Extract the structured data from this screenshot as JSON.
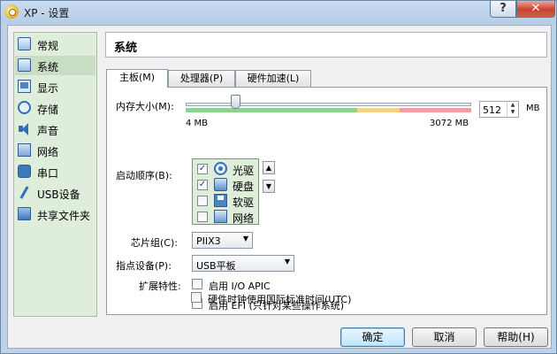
{
  "window": {
    "title": "XP - 设置",
    "help_symbol": "?",
    "close_symbol": "✕"
  },
  "sidebar": {
    "items": [
      {
        "label": "常规",
        "icon": "general-icon"
      },
      {
        "label": "系统",
        "icon": "system-icon",
        "selected": true
      },
      {
        "label": "显示",
        "icon": "display-icon"
      },
      {
        "label": "存储",
        "icon": "storage-icon"
      },
      {
        "label": "声音",
        "icon": "audio-icon"
      },
      {
        "label": "网络",
        "icon": "network-icon"
      },
      {
        "label": "串口",
        "icon": "serial-port-icon"
      },
      {
        "label": "USB设备",
        "icon": "usb-icon"
      },
      {
        "label": "共享文件夹",
        "icon": "shared-folder-icon"
      }
    ]
  },
  "header": {
    "title": "系统"
  },
  "tabs": [
    {
      "label": "主板(M)",
      "active": true
    },
    {
      "label": "处理器(P)"
    },
    {
      "label": "硬件加速(L)"
    }
  ],
  "memory": {
    "label": "内存大小(M):",
    "value": "512",
    "unit": "MB",
    "min_label": "4  MB",
    "max_label": "3072  MB",
    "min": 4,
    "max": 3072,
    "current": 512
  },
  "boot": {
    "label": "启动顺序(B):",
    "devices": [
      {
        "label": "光驱",
        "checked": "✓",
        "icon": "optical-drive-icon"
      },
      {
        "label": "硬盘",
        "checked": "✓",
        "icon": "hard-disk-icon"
      },
      {
        "label": "软驱",
        "checked": "",
        "icon": "floppy-icon"
      },
      {
        "label": "网络",
        "checked": "",
        "icon": "network-boot-icon"
      }
    ],
    "up_symbol": "▲",
    "down_symbol": "▼"
  },
  "chipset": {
    "label": "芯片组(C):",
    "value": "PIIX3"
  },
  "pointing": {
    "label": "指点设备(P):",
    "value": "USB平板"
  },
  "extended": {
    "label": "扩展特性:",
    "options": [
      {
        "label": "启用 I/O APIC",
        "checked": ""
      },
      {
        "label": "启用 EFI (只针对某些操作系统)",
        "checked": ""
      },
      {
        "label": "硬件时钟使用国际标准时间(UTC)",
        "checked": ""
      }
    ]
  },
  "buttons": {
    "ok": "确定",
    "cancel": "取消",
    "help": "帮助(H)"
  },
  "dropdown_symbol": "▼",
  "colors": {
    "sidebar_bg": "#dfeedb",
    "title_bar": "#b5cde6",
    "slider_green": "#8fd28f",
    "slider_red": "#f0a0a0"
  }
}
